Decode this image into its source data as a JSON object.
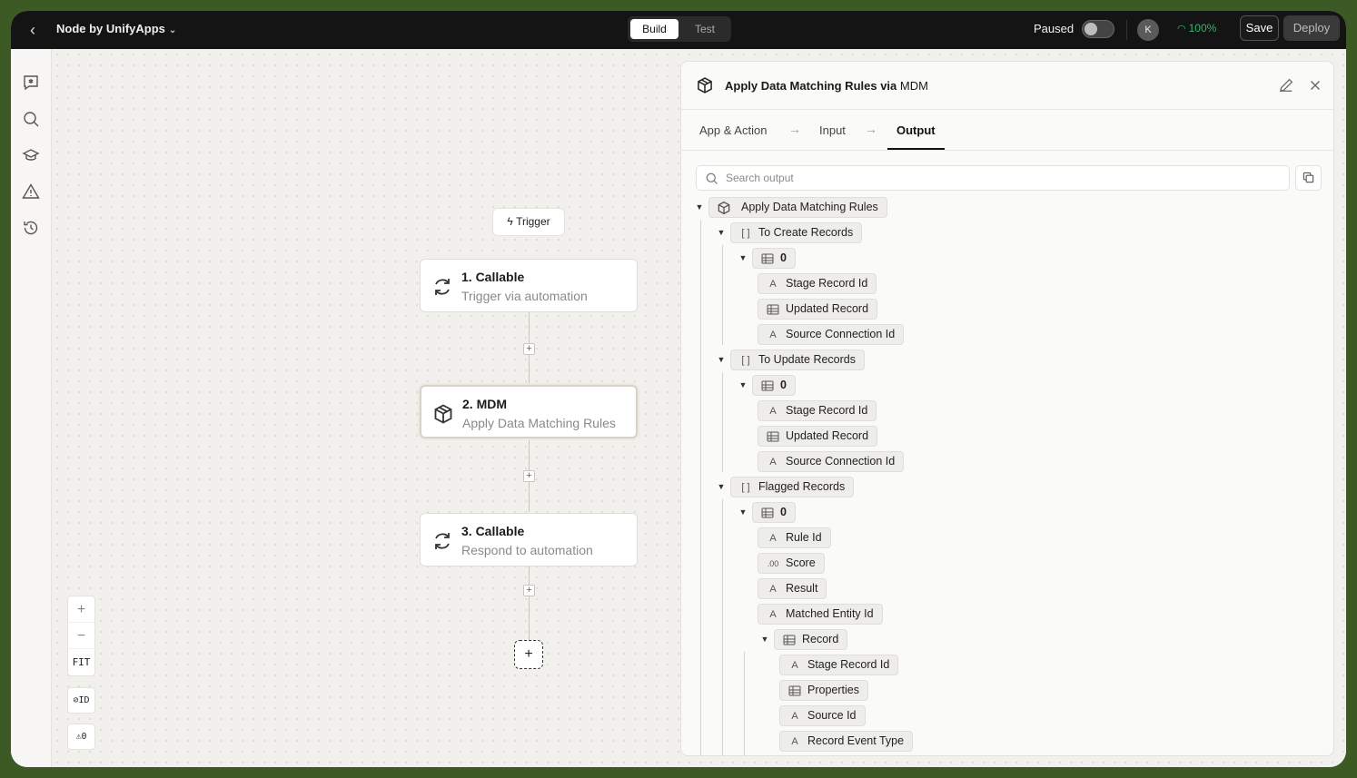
{
  "topbar": {
    "title": "Node by UnifyApps",
    "modes": [
      "Build",
      "Test"
    ],
    "active_mode": "Build",
    "paused_label": "Paused",
    "avatar_initial": "K",
    "health": "100%",
    "save_label": "Save",
    "deploy_label": "Deploy"
  },
  "canvas": {
    "trigger_label": "Trigger",
    "nodes": [
      {
        "title": "1. Callable",
        "subtitle": "Trigger via automation"
      },
      {
        "title": "2. MDM",
        "subtitle": "Apply Data Matching Rules"
      },
      {
        "title": "3. Callable",
        "subtitle": "Respond to automation"
      }
    ],
    "zoom": {
      "plus": "+",
      "minus": "−",
      "fit": "FIT"
    },
    "chips": {
      "id": "⊘ID",
      "warn": "⚠0"
    }
  },
  "panel": {
    "title_bold": "Apply Data Matching Rules via",
    "title_app": "MDM",
    "tabs": [
      "App & Action",
      "Input",
      "Output"
    ],
    "active_tab": "Output",
    "search_placeholder": "Search output",
    "tree": [
      {
        "label": "Apply Data Matching Rules",
        "type": "object",
        "icon": "cube-icon"
      },
      {
        "label": "To Create Records",
        "type": "array",
        "icon": "array-icon"
      },
      {
        "label": "0",
        "type": "object",
        "icon": "table-icon"
      },
      {
        "label": "Stage Record Id",
        "type": "string",
        "icon": "text-icon"
      },
      {
        "label": "Updated Record",
        "type": "object",
        "icon": "table-icon"
      },
      {
        "label": "Source Connection Id",
        "type": "string",
        "icon": "text-icon"
      },
      {
        "label": "To Update Records",
        "type": "array",
        "icon": "array-icon"
      },
      {
        "label": "0",
        "type": "object",
        "icon": "table-icon"
      },
      {
        "label": "Stage Record Id",
        "type": "string",
        "icon": "text-icon"
      },
      {
        "label": "Updated Record",
        "type": "object",
        "icon": "table-icon"
      },
      {
        "label": "Source Connection Id",
        "type": "string",
        "icon": "text-icon"
      },
      {
        "label": "Flagged Records",
        "type": "array",
        "icon": "array-icon"
      },
      {
        "label": "0",
        "type": "object",
        "icon": "table-icon"
      },
      {
        "label": "Rule Id",
        "type": "string",
        "icon": "text-icon"
      },
      {
        "label": "Score",
        "type": "number",
        "icon": "number-icon"
      },
      {
        "label": "Result",
        "type": "string",
        "icon": "text-icon"
      },
      {
        "label": "Matched Entity Id",
        "type": "string",
        "icon": "text-icon"
      },
      {
        "label": "Record",
        "type": "object",
        "icon": "table-icon"
      },
      {
        "label": "Stage Record Id",
        "type": "string",
        "icon": "text-icon"
      },
      {
        "label": "Properties",
        "type": "object",
        "icon": "table-icon"
      },
      {
        "label": "Source Id",
        "type": "string",
        "icon": "text-icon"
      },
      {
        "label": "Record Event Type",
        "type": "string",
        "icon": "text-icon"
      }
    ]
  }
}
